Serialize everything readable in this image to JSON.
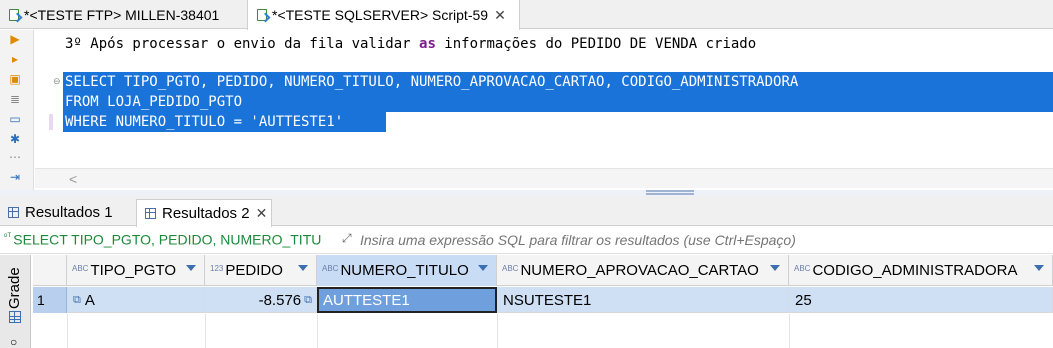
{
  "editor_tabs": [
    {
      "label": "*<TESTE FTP> MILLEN-38401",
      "active": false
    },
    {
      "label": "*<TESTE SQLSERVER> Script-59",
      "active": true,
      "close": "✕"
    }
  ],
  "editor": {
    "comment_line": {
      "before": "3º Após processar o envio da fila validar ",
      "keyword": "as",
      "after": " informações do PEDIDO DE VENDA criado"
    },
    "selected_lines": [
      "SELECT TIPO_PGTO, PEDIDO, NUMERO_TITULO, NUMERO_APROVACAO_CARTAO, CODIGO_ADMINISTRADORA",
      "FROM LOJA_PEDIDO_PGTO",
      "WHERE NUMERO_TITULO = 'AUTTESTE1'"
    ],
    "scroll_left": "<"
  },
  "result_tabs": [
    {
      "label": "Resultados 1",
      "active": false
    },
    {
      "label": "Resultados 2",
      "active": true,
      "close": "✕"
    }
  ],
  "filter": {
    "query_prefix": "ᵒᵀ",
    "query_text": "SELECT TIPO_PGTO, PEDIDO, NUMERO_TITU",
    "placeholder": "Insira uma expressão SQL para filtrar os resultados (use Ctrl+Espaço)"
  },
  "side_panel": {
    "label": "Grade"
  },
  "grid": {
    "columns": [
      {
        "type_badge": "ABC",
        "name": "TIPO_PGTO"
      },
      {
        "type_badge": "123",
        "name": "PEDIDO"
      },
      {
        "type_badge": "ABC",
        "name": "NUMERO_TITULO"
      },
      {
        "type_badge": "ABC",
        "name": "NUMERO_APROVACAO_CARTAO"
      },
      {
        "type_badge": "ABC",
        "name": "CODIGO_ADMINISTRADORA"
      }
    ],
    "rows": [
      {
        "row_number": "1",
        "cells": [
          "A",
          "-8.576",
          "AUTTESTE1",
          "NSUTESTE1",
          "25"
        ]
      }
    ]
  },
  "colors": {
    "selection": "#1a73d9",
    "active_column": "#c9dcf5",
    "row_highlight": "#cfe0f5",
    "filter_query": "#1c8a3a"
  }
}
